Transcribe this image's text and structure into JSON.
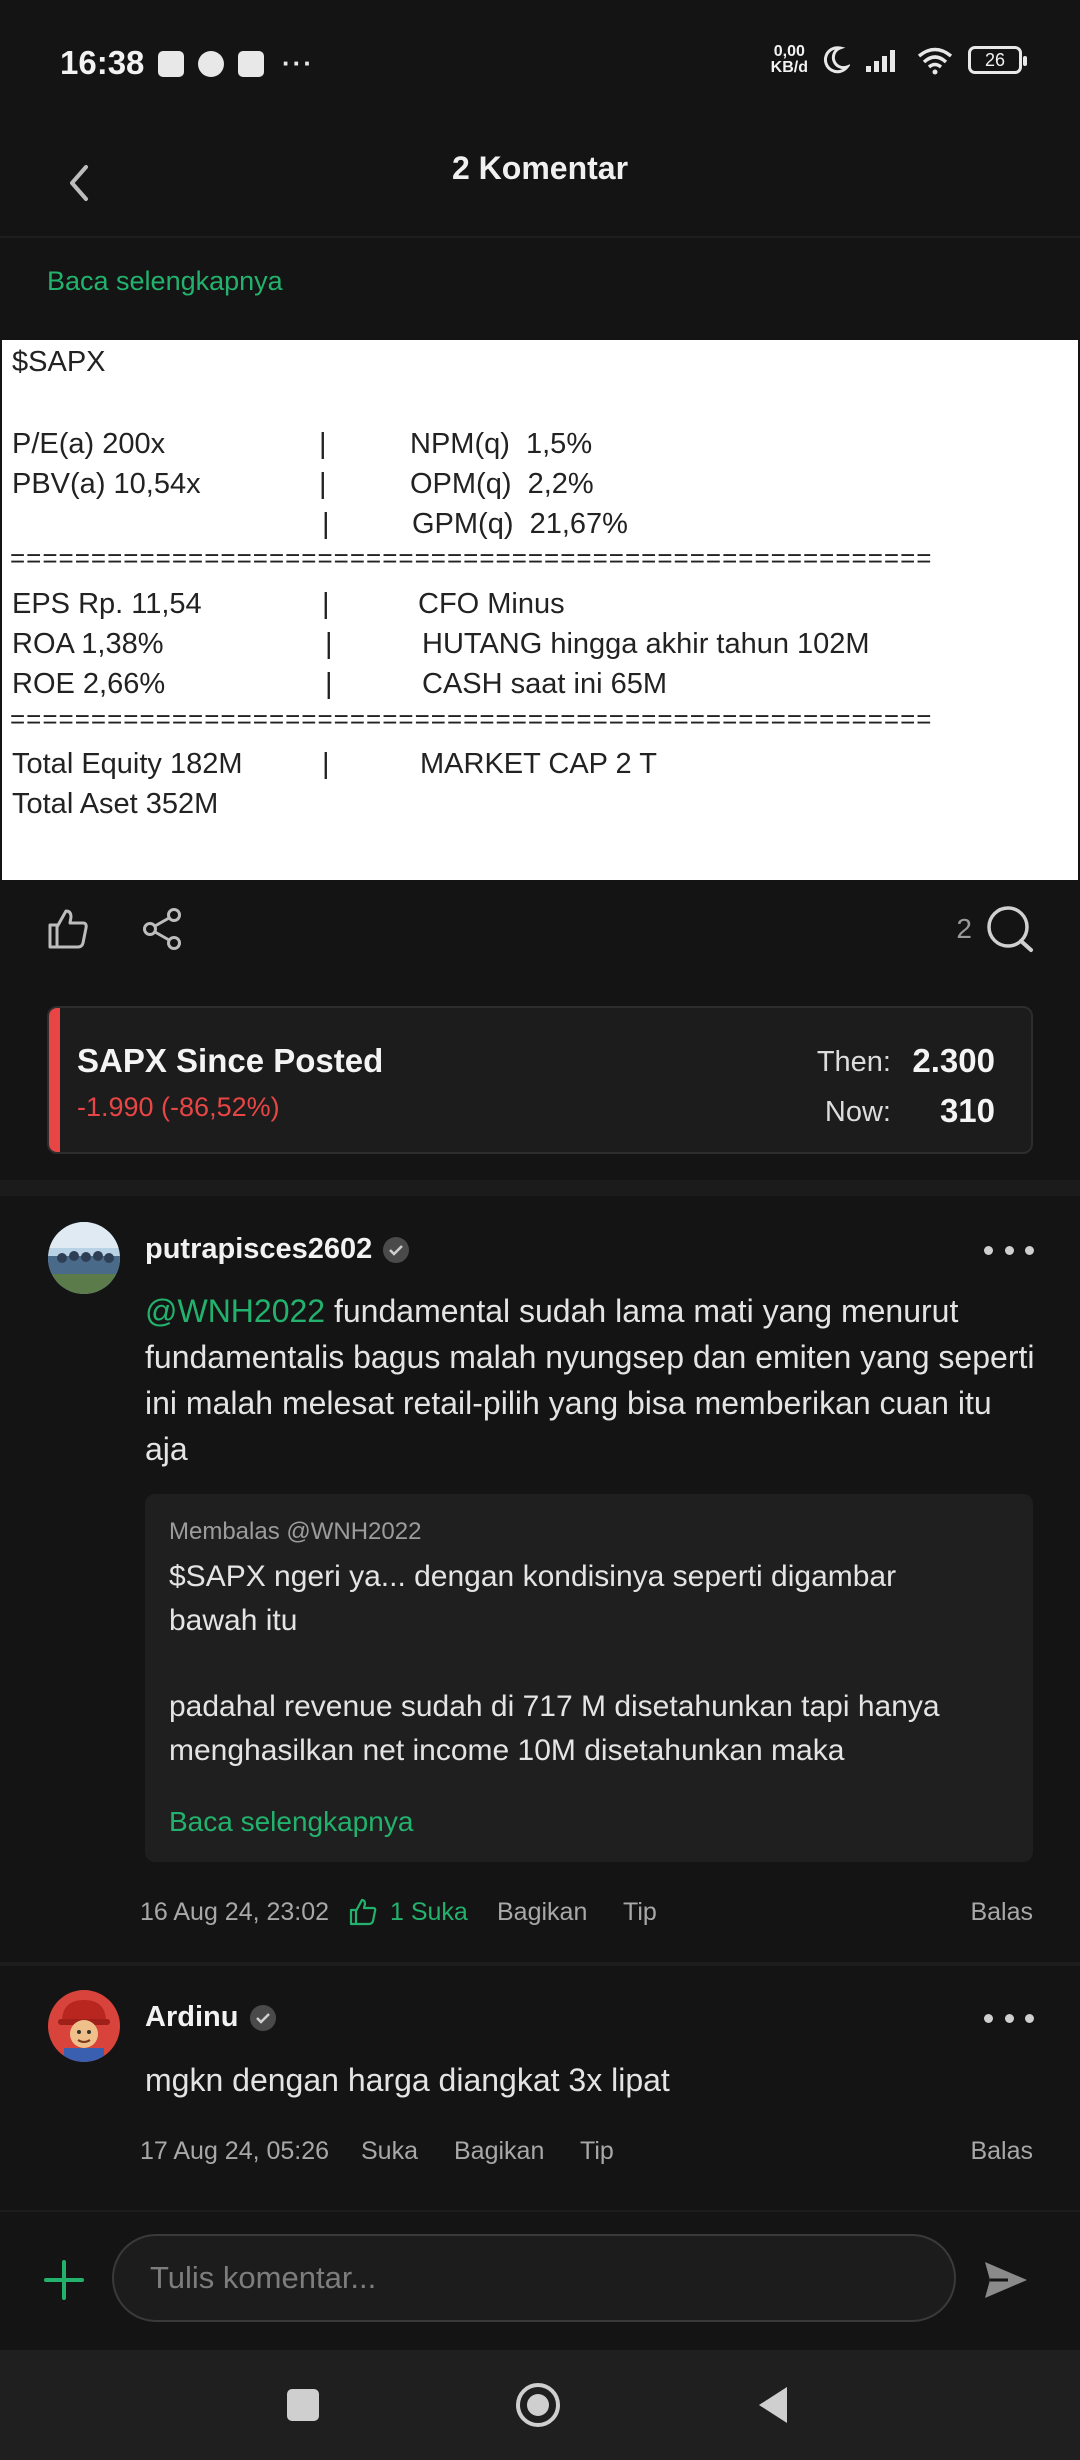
{
  "status_bar": {
    "time": "16:38",
    "net_speed_top": "0,00",
    "net_speed_bottom": "KB/d",
    "battery": "26"
  },
  "header": {
    "title": "2 Komentar"
  },
  "post": {
    "read_more": "Baca selengkapnya",
    "image_text": {
      "ticker": "$SAPX",
      "pe": "P/E(a) 200x",
      "npm": "NPM(q)  1,5%",
      "pbv": "PBV(a) 10,54x",
      "opm": "OPM(q)  2,2%",
      "gpm": "GPM(q)  21,67%",
      "eps": "EPS Rp. 11,54",
      "cfo": "CFO Minus",
      "roa": "ROA 1,38%",
      "hutang": "HUTANG hingga akhir tahun 102M",
      "roe": "ROE 2,66%",
      "cash": "CASH saat ini 65M",
      "equity": "Total Equity 182M",
      "mcap": "MARKET CAP 2 T",
      "aset": "Total Aset 352M",
      "pipe": "|",
      "divider": "========================================================="
    },
    "comment_count": "2"
  },
  "price_card": {
    "title": "SAPX Since Posted",
    "change": "-1.990 (-86,52%)",
    "then_label": "Then:",
    "then_value": "2.300",
    "now_label": "Now:",
    "now_value": "310",
    "accent": "#e84545"
  },
  "comments": [
    {
      "username": "putrapisces2602",
      "mention": "@WNH2022",
      "text": " fundamental sudah lama mati yang menurut fundamentalis bagus malah nyungsep dan emiten yang seperti ini malah melesat retail-pilih yang bisa memberikan cuan itu aja",
      "quote": {
        "reply_to": "Membalas @WNH2022",
        "line1": "$SAPX ngeri ya... dengan kondisinya seperti digambar",
        "line2": "bawah itu",
        "line3": "padahal revenue sudah di 717 M disetahunkan tapi hanya",
        "line4": "menghasilkan net income 10M disetahunkan maka",
        "read_more": "Baca selengkapnya"
      },
      "timestamp": "16 Aug 24, 23:02",
      "like_label": "1 Suka",
      "share_label": "Bagikan",
      "tip_label": "Tip",
      "reply_label": "Balas"
    },
    {
      "username": "Ardinu",
      "text": "mgkn dengan harga diangkat 3x lipat",
      "timestamp": "17 Aug 24, 05:26",
      "like_label": "Suka",
      "share_label": "Bagikan",
      "tip_label": "Tip",
      "reply_label": "Balas"
    }
  ],
  "input": {
    "placeholder": "Tulis komentar..."
  },
  "colors": {
    "accent_green": "#23b26d",
    "negative_red": "#e84545",
    "background": "#141414"
  }
}
